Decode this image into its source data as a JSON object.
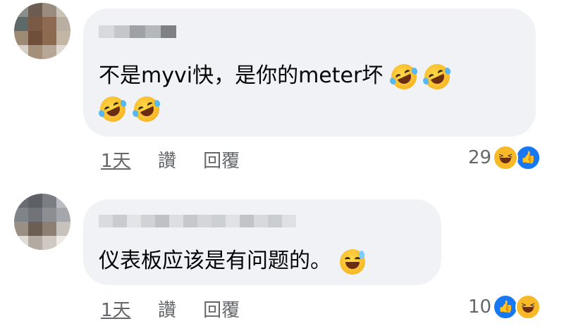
{
  "comments": [
    {
      "text": "不是myvi快，是你的meter坏",
      "emojis": [
        "rolling-on-floor-laughing",
        "rolling-on-floor-laughing",
        "rolling-on-floor-laughing",
        "rolling-on-floor-laughing"
      ],
      "time": "1天",
      "like_label": "讚",
      "reply_label": "回覆",
      "reaction_count": "29",
      "reactions": [
        "haha",
        "like"
      ]
    },
    {
      "text": "仪表板应该是有问题的。",
      "emojis": [
        "grinning-face-with-sweat"
      ],
      "time": "1天",
      "like_label": "讚",
      "reply_label": "回覆",
      "reaction_count": "10",
      "reactions": [
        "like",
        "haha"
      ]
    }
  ],
  "colors": {
    "bubble": "#f0f2f5",
    "text": "#050505",
    "meta": "#65676b",
    "like": "#1877f2",
    "haha": "#f7b928"
  }
}
